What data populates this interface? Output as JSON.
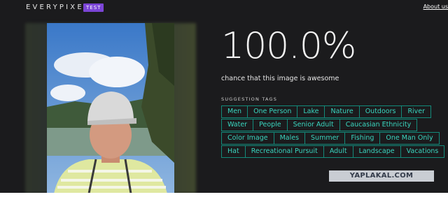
{
  "header": {
    "logo": "EVERYPIXEL",
    "badge": "TEST",
    "about_link": "About us"
  },
  "result": {
    "score": "100.0%",
    "score_caption": "chance that this image is awesome"
  },
  "tags_section": {
    "label": "SUGGESTION TAGS",
    "rows": [
      [
        "Men",
        "One Person",
        "Lake",
        "Nature",
        "Outdoors",
        "River"
      ],
      [
        "Water",
        "People",
        "Senior Adult",
        "Caucasian Ethnicity"
      ],
      [
        "Color Image",
        "Males",
        "Summer",
        "Fishing",
        "One Man Only"
      ],
      [
        "Hat",
        "Recreational Pursuit",
        "Adult",
        "Landscape",
        "Vacations"
      ]
    ]
  },
  "watermark": "YAPLAKAL.COM",
  "colors": {
    "accent": "#7b45d6",
    "tag_border": "#138a7a",
    "tag_text": "#3ad5bf",
    "background": "#1b1b1d"
  }
}
